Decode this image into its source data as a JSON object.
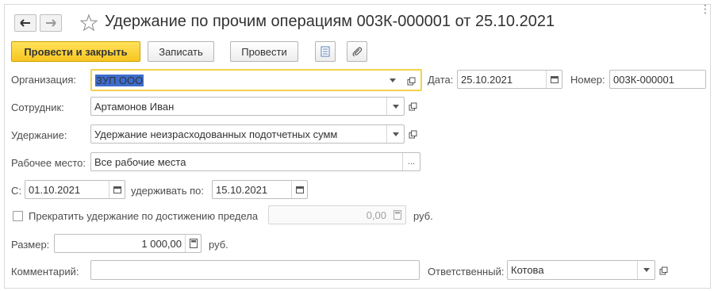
{
  "window": {
    "title": "Удержание по прочим операциям 003К-000001 от 25.10.2021"
  },
  "toolbar": {
    "post_and_close": "Провести и закрыть",
    "save": "Записать",
    "post": "Провести"
  },
  "form": {
    "organization": {
      "label": "Организация:",
      "value": "ЗУП ООО"
    },
    "date": {
      "label": "Дата:",
      "value": "25.10.2021"
    },
    "number": {
      "label": "Номер:",
      "value": "003К-000001"
    },
    "employee": {
      "label": "Сотрудник:",
      "value": "Артамонов Иван"
    },
    "deduction": {
      "label": "Удержание:",
      "value": "Удержание неизрасходованных подотчетных сумм"
    },
    "workplace": {
      "label": "Рабочее место:",
      "value": "Все рабочие места",
      "button": "..."
    },
    "from": {
      "label": "С:",
      "value": "01.10.2021"
    },
    "until": {
      "label": "удерживать по:",
      "value": "15.10.2021"
    },
    "stop_limit": {
      "label": "Прекратить удержание по достижению предела",
      "value": "0,00",
      "unit": "руб.",
      "checked": false
    },
    "amount": {
      "label": "Размер:",
      "value": "1 000,00",
      "unit": "руб."
    },
    "comment": {
      "label": "Комментарий:",
      "value": ""
    },
    "responsible": {
      "label": "Ответственный:",
      "value": "Котова"
    }
  }
}
